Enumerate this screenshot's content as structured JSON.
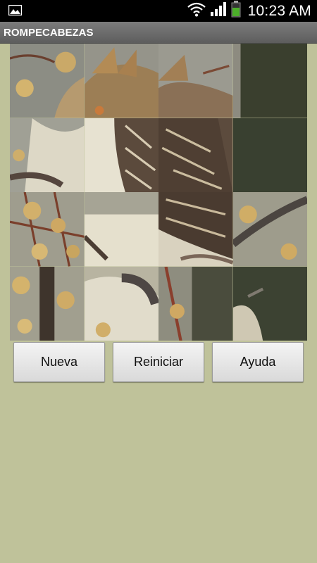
{
  "status_bar": {
    "time": "10:23 AM",
    "icons": [
      "gallery-icon",
      "wifi-icon",
      "signal-icon",
      "battery-icon"
    ]
  },
  "app": {
    "title": "ROMPECABEZAS"
  },
  "puzzle": {
    "grid_size": 4,
    "image_subject": "bird",
    "tiles_description": "scrambled 4x4 image tiles of a bird on a branch with berries; one blank dark tile region on right"
  },
  "buttons": {
    "new_label": "Nueva",
    "reset_label": "Reiniciar",
    "help_label": "Ayuda"
  },
  "colors": {
    "background": "#bfc29a",
    "title_bar": "#6b6b6b",
    "status_bar": "#000000",
    "battery": "#4caf2a"
  }
}
